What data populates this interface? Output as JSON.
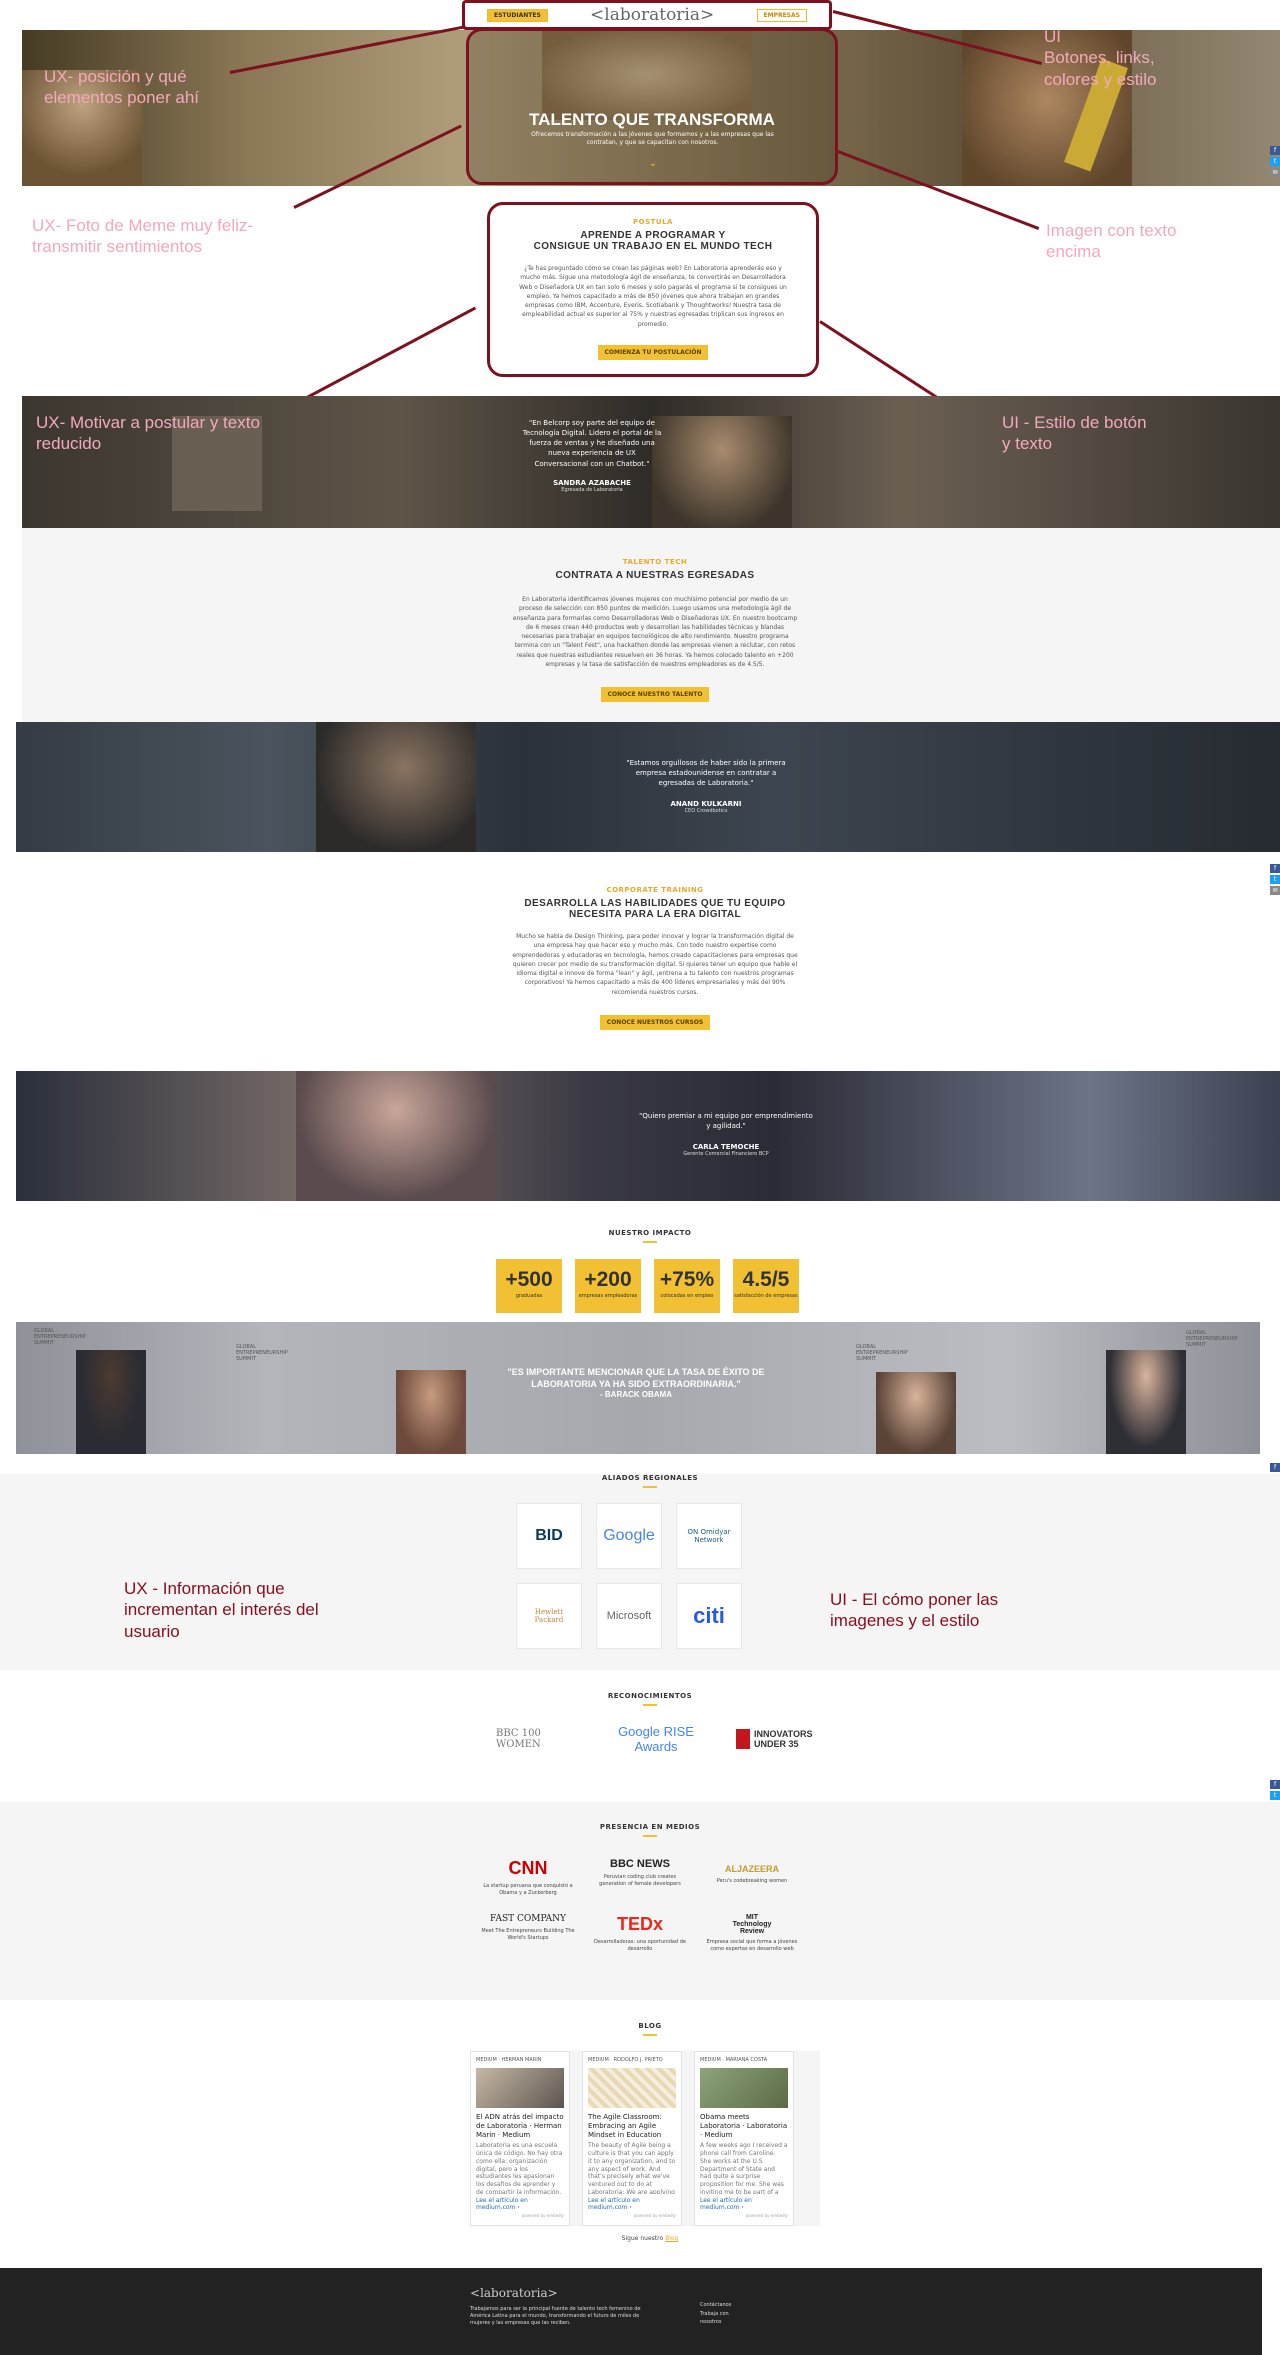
{
  "nav": {
    "left_btn": "ESTUDIANTES",
    "logo": "laboratoria",
    "right_btn": "EMPRESAS"
  },
  "hero": {
    "title": "TALENTO QUE TRANSFORMA",
    "subtitle": "Ofrecemos transformación a las jóvenes que formamos y a las empresas que las contratan, y que se capacitan con nosotros."
  },
  "annotations": {
    "a1": "UX- posición y qué elementos poner ahí",
    "a2": "UI\nBotones, links, colores y estilo",
    "a3": "UX- Foto de Meme muy feliz- transmitir sentimientos",
    "a4": "Imagen con texto encima",
    "a5": "UX- Motivar a postular y texto reducido",
    "a6": "UI - Estilo de botón y texto",
    "a7": "UX - Información que incrementan el interés del usuario",
    "a8": "UI - El cómo poner las imagenes y el estilo"
  },
  "intro": {
    "kicker": "POSTULA",
    "title1": "APRENDE A PROGRAMAR Y",
    "title2": "CONSIGUE UN TRABAJO EN EL MUNDO TECH",
    "text": "¿Te has preguntado cómo se crean las páginas web? En Laboratoria aprenderás eso y mucho más. Sigue una metodología ágil de enseñanza, te convertirás en Desarrolladora Web o Diseñadora UX en tan solo 6 meses y solo pagarás el programa si te consigues un empleo. Ya hemos capacitado a más de 850 jóvenes que ahora trabajan en grandes empresas como IBM, Accenture, Everis, Scotiabank y Thoughtworks! Nuestra tasa de empleabilidad actual es superior al 75% y nuestras egresadas triplican sus ingresos en promedio.",
    "button": "COMIENZA TU POSTULACIÓN"
  },
  "quote1": {
    "text": "\"En Belcorp soy parte del equipo de Tecnología Digital. Lidero el portal de la fuerza de ventas y he diseñado una nueva experiencia de UX Conversacional con un Chatbot.\"",
    "name": "SANDRA AZABACHE",
    "role": "Egresada de Laboratoria"
  },
  "hire": {
    "kicker": "TALENTO TECH",
    "title": "CONTRATA A NUESTRAS EGRESADAS",
    "text": "En Laboratoria identificamos jóvenes mujeres con muchísimo potencial por medio de un proceso de selección con 850 puntos de medición. Luego usamos una metodología ágil de enseñanza para formarlas como Desarrolladoras Web o Diseñadoras UX. En nuestro bootcamp de 6 meses crean 440 productos web y desarrollan las habilidades técnicas y blandas necesarias para trabajar en equipos tecnológicos de alto rendimiento. Nuestro programa termina con un \"Talent Fest\", una hackathon donde las empresas vienen a reclutar, con retos reales que nuestras estudiantes resuelven en 36 horas. Ya hemos colocado talento en +200 empresas y la tasa de satisfacción de nuestros empleadores es de 4.5/5.",
    "button": "CONOCE NUESTRO TALENTO"
  },
  "quote2": {
    "text": "\"Estamos orgullosos de haber sido la primera empresa estadounidense en contratar a egresadas de Laboratoria.\"",
    "name": "ANAND KULKARNI",
    "role": "CEO Crowdbotics"
  },
  "training": {
    "kicker": "CORPORATE TRAINING",
    "title1": "DESARROLLA LAS HABILIDADES QUE TU EQUIPO",
    "title2": "NECESITA PARA LA ERA DIGITAL",
    "text": "Mucho se habla de Design Thinking, para poder innovar y lograr la transformación digital de una empresa hay que hacer eso y mucho más. Con todo nuestro expertise como emprendedoras y educadoras en tecnología, hemos creado capacitaciones para empresas que quieren crecer por medio de su transformación digital. Si quieres tener un equipo que hable el idioma digital e innove de forma \"lean\" y ágil, ¡entrena a tu talento con nuestros programas corporativos! Ya hemos capacitado a más de 400 líderes empresariales y más del 90% recomienda nuestros cursos.",
    "button": "CONOCE NUESTROS CURSOS"
  },
  "quote3": {
    "text": "\"Quiero premiar a mi equipo por emprendimiento y agilidad.\"",
    "name": "CARLA TEMOCHE",
    "role": "Gerente Comercial Financiero BCP"
  },
  "impact": {
    "title": "NUESTRO IMPACTO",
    "stats": [
      {
        "value": "+500",
        "label": "graduadas"
      },
      {
        "value": "+200",
        "label": "empresas empleadoras"
      },
      {
        "value": "+75%",
        "label": "colocadas en empleo"
      },
      {
        "value": "4.5/5",
        "label": "satisfacción de empresas"
      }
    ]
  },
  "obama": {
    "quote": "\"ES IMPORTANTE MENCIONAR QUE LA TASA DE ÉXITO DE LABORATORIA YA HA SIDO EXTRAORDINARIA.\"",
    "author": "- BARACK OBAMA",
    "banner": "GLOBAL ENTREPRENEURSHIP SUMMIT"
  },
  "allies": {
    "title": "ALIADOS REGIONALES",
    "logos": [
      "BID",
      "Google",
      "ON Omidyar Network",
      "Hewlett Packard",
      "Microsoft",
      "citi"
    ]
  },
  "recognitions": {
    "title": "RECONOCIMIENTOS",
    "logos": [
      "BBC 100 WOMEN",
      "Google RISE Awards",
      "INNOVATORS UNDER 35"
    ]
  },
  "media": {
    "title": "PRESENCIA EN MEDIOS",
    "items": [
      {
        "logo": "CNN",
        "desc": "La startup peruana que conquistó a Obama y a Zuckerberg"
      },
      {
        "logo": "BBC NEWS",
        "desc": "Peruvian coding club creates generation of female developers"
      },
      {
        "logo": "ALJAZEERA",
        "desc": "Peru's codebreaking women"
      },
      {
        "logo": "FAST COMPANY",
        "desc": "Meet The Entrepreneurs Building The World's Startups"
      },
      {
        "logo": "TEDx",
        "desc": "Desarrolladoras: una oportunidad de desarrollo"
      },
      {
        "logo": "MIT Technology Review",
        "desc": "Empresa social que forma a jóvenes como expertas en desarrollo web"
      }
    ]
  },
  "blog": {
    "title": "BLOG",
    "footer_text": "Sigue nuestro",
    "footer_link": "Blog",
    "posts": [
      {
        "source": "MEDIUM",
        "author": "HERMAN MARIN",
        "title": "El ADN atrás del impacto de Laboratoria · Herman Marin · Medium",
        "body": "Laboratoria es una escuela única de código. No hay otra como ella: organización digital, pero a los estudiantes les apasionan los desafíos de aprender y de compartir la información.",
        "link": "Lee el artículo en medium.com ›",
        "via": "powered by embedly"
      },
      {
        "source": "MEDIUM",
        "author": "RODOLFO J. PRIETO",
        "title": "The Agile Classroom: Embracing an Agile Mindset in Education",
        "body": "The beauty of Agile being a culture is that you can apply it to any organization, and to any aspect of work. And that's precisely what we've ventured out to do at Laboratoria: We are applying Agile values and principles to education. Other Scrums have been in the Agile culture and have shaped a learning approach towards teaching coding at Laboratoria.",
        "link": "Lee el artículo en medium.com ›",
        "via": "powered by embedly"
      },
      {
        "source": "MEDIUM",
        "author": "MARIANA COSTA",
        "title": "Obama meets Laboratoria · Laboratoria · Medium",
        "body": "A few weeks ago I received a phone call from Caroline. She works at the U.S Department of State and had quite a surprise proposition for me. She was inviting me to be part of a session of the Global...",
        "link": "Lee el artículo en medium.com ›",
        "via": "powered by embedly"
      }
    ]
  },
  "footer": {
    "logo": "laboratoria",
    "text": "Trabajamos para ser la principal fuente de talento tech femenino de América Latina para el mundo, transformando el futuro de miles de mujeres y las empresas que las reciben.",
    "links": [
      "Contáctanos",
      "Trabaja con",
      "nosotros"
    ]
  },
  "social": [
    "f",
    "t",
    "✉"
  ],
  "colors": {
    "accent": "#f2c033",
    "annotation_line": "#7c1120",
    "annotation_text": "#f4a8bc",
    "footer_bg": "#222222"
  }
}
